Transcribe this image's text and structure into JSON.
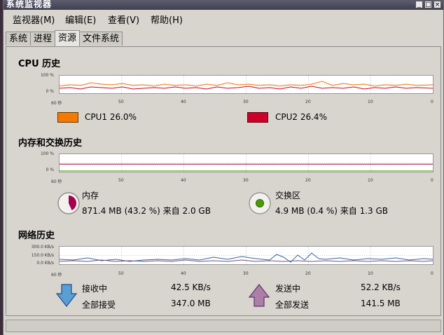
{
  "window": {
    "title": "系统监视器"
  },
  "menubar": {
    "items": [
      "监视器(M)",
      "编辑(E)",
      "查看(V)",
      "帮助(H)"
    ]
  },
  "tabs": [
    "系统",
    "进程",
    "资源",
    "文件系统"
  ],
  "cpu": {
    "section_title": "CPU 历史",
    "y_labels": [
      "100 %",
      "0 %"
    ],
    "x_labels": [
      "60 秒",
      "50",
      "40",
      "30",
      "20",
      "10",
      "0"
    ],
    "cpu1": {
      "label": "CPU1  26.0%",
      "color": "#f57900"
    },
    "cpu2": {
      "label": "CPU2  26.4%",
      "color": "#cc0029"
    }
  },
  "memory": {
    "section_title": "内存和交换历史",
    "y_labels": [
      "100 %",
      "0 %"
    ],
    "x_labels": [
      "60 秒",
      "50",
      "40",
      "30",
      "20",
      "10",
      "0"
    ],
    "mem_label": "内存",
    "mem_value": "871.4 MB (43.2 %) 来自 2.0 GB",
    "mem_fraction": 0.432,
    "mem_color": "#a4004f",
    "swap_label": "交换区",
    "swap_value": "4.9 MB (0.4 %) 来自 1.3 GB",
    "swap_fraction": 0.004,
    "swap_color": "#4e9a06"
  },
  "network": {
    "section_title": "网络历史",
    "y_labels": [
      "300.0 KB/s",
      "150.0 KB/s",
      "0.0 KB/s"
    ],
    "x_labels": [
      "60 秒",
      "50",
      "40",
      "30",
      "20",
      "10",
      "0"
    ],
    "recv_label": "接收中",
    "recv_rate": "42.5 KB/s",
    "recv_total_label": "全部接受",
    "recv_total": "347.0 MB",
    "send_label": "发送中",
    "send_rate": "52.2 KB/s",
    "send_total_label": "全部发送",
    "send_total": "141.5 MB",
    "recv_color": "#3465a4",
    "send_color": "#75507b"
  }
}
